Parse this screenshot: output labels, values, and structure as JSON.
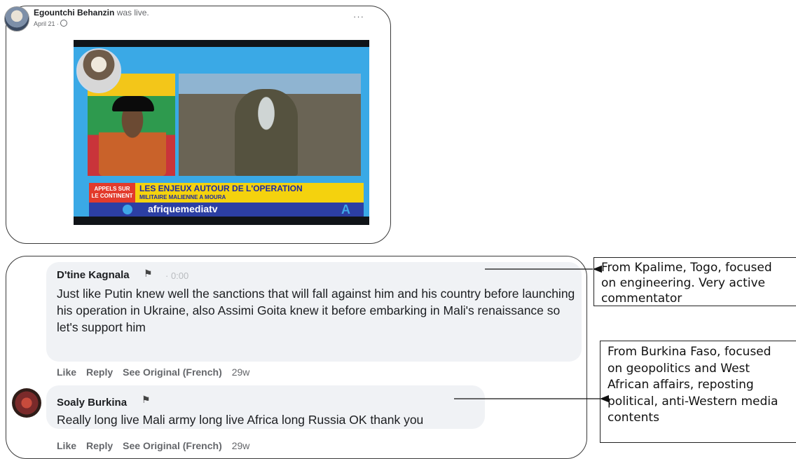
{
  "post": {
    "author": "Egountchi Behanzin",
    "verb": "was live.",
    "date": "April 21 ·",
    "more": "···",
    "video": {
      "tag_line1": "APPELS SUR",
      "tag_line2": "LE CONTINENT",
      "headline": "LES ENJEUX AUTOUR DE L'OPERATION",
      "subline": "MILITAIRE MALIENNE A MOURA",
      "handle": "afriquemediatv",
      "logo": "A"
    }
  },
  "comments": [
    {
      "name": "D'tine Kagnala",
      "flag": "⚑",
      "time": "· 0:00",
      "text": "Just like Putin knew well the sanctions that will fall against him and his country before launching his operation in Ukraine, also Assimi Goita knew it before embarking in Mali's renaissance so let's support him",
      "actions": {
        "like": "Like",
        "reply": "Reply",
        "see_original": "See Original (French)",
        "age": "29w"
      }
    },
    {
      "name": "Soaly Burkina",
      "flag": "⚑",
      "text": "Really long live Mali army long live Africa long Russia OK thank you",
      "actions": {
        "like": "Like",
        "reply": "Reply",
        "see_original": "See Original (French)",
        "age": "29w"
      }
    }
  ],
  "annotations": {
    "note1": [
      "From Kpalime, Togo, focused",
      "on engineering. Very active",
      "commentator"
    ],
    "note2": [
      "From Burkina Faso, focused",
      "on geopolitics and West",
      "African affairs, reposting",
      "political, anti-Western media",
      "contents"
    ]
  }
}
